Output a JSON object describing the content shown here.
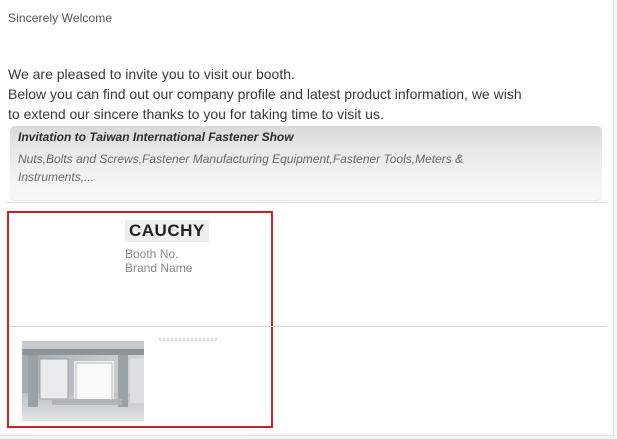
{
  "header": {
    "greeting": "Sincerely Welcome"
  },
  "intro": {
    "line1": "We are pleased to invite you to visit our booth.",
    "line2": "Below you can find out our company profile and latest product information, we wish",
    "line3": "to extend our sincere thanks to you for taking time to visit us."
  },
  "banner": {
    "title": "Invitation to Taiwan International Fastener Show",
    "description": "Nuts,Bolts and Screws,Fastener Manufacturing Equipment,Fastener Tools,Meters & Instruments,..."
  },
  "booth": {
    "company": "CAUCHY",
    "booth_label": "Booth No.",
    "brand_label": "Brand Name",
    "image_icon": "booth-photo-icon"
  },
  "colors": {
    "highlight_border": "#cc1f27",
    "banner_top": "#d9d9d9",
    "banner_bottom": "#f8f8f8"
  }
}
